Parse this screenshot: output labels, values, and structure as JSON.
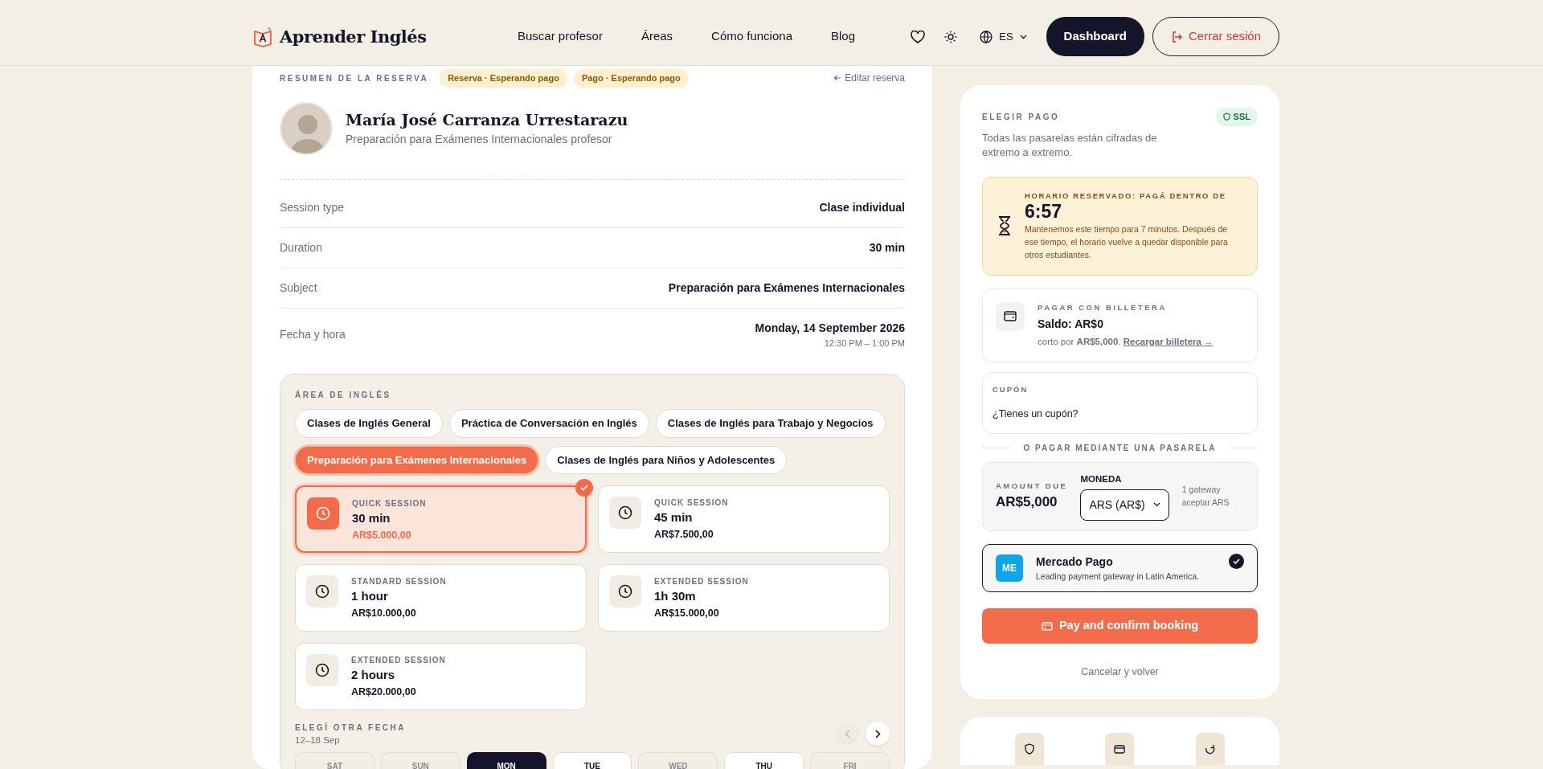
{
  "header": {
    "logo": "Aprender Inglés",
    "nav": [
      "Buscar profesor",
      "Áreas",
      "Cómo funciona",
      "Blog"
    ],
    "language": "ES",
    "dashboard": "Dashboard",
    "logout": "Cerrar sesión"
  },
  "summary": {
    "title": "RESUMEN DE LA RESERVA",
    "badges": [
      "Reserva · Esperando pago",
      "Pago · Esperando pago"
    ],
    "edit_link": "Editar reserva",
    "teacher": {
      "name": "María José Carranza Urrestarazu",
      "subtitle": "Preparación para Exámenes Internacionales profesor"
    },
    "rows": [
      {
        "label": "Session type",
        "value": "Clase individual"
      },
      {
        "label": "Duration",
        "value": "30 min"
      },
      {
        "label": "Subject",
        "value": "Preparación para Exámenes Internacionales"
      },
      {
        "label": "Fecha y hora",
        "value": "Monday, 14 September 2026",
        "subvalue": "12:30 PM – 1:00 PM"
      }
    ]
  },
  "area": {
    "title": "ÁREA DE INGLÉS",
    "chips": [
      {
        "label": "Clases de Inglés General",
        "selected": false
      },
      {
        "label": "Práctica de Conversación en Inglés",
        "selected": false
      },
      {
        "label": "Clases de Inglés para Trabajo y Negocios",
        "selected": false
      },
      {
        "label": "Preparación para Exámenes Internacionales",
        "selected": true
      },
      {
        "label": "Clases de Inglés para Niños y Adolescentes",
        "selected": false
      }
    ],
    "sessions": [
      {
        "type": "QUICK SESSION",
        "duration": "30 min",
        "price": "AR$5.000,00",
        "selected": true
      },
      {
        "type": "QUICK SESSION",
        "duration": "45 min",
        "price": "AR$7.500,00",
        "selected": false
      },
      {
        "type": "STANDARD SESSION",
        "duration": "1 hour",
        "price": "AR$10.000,00",
        "selected": false
      },
      {
        "type": "EXTENDED SESSION",
        "duration": "1h 30m",
        "price": "AR$15.000,00",
        "selected": false
      },
      {
        "type": "EXTENDED SESSION",
        "duration": "2 hours",
        "price": "AR$20.000,00",
        "selected": false
      }
    ],
    "date_picker": {
      "title": "ELEGÍ OTRA FECHA",
      "range": "12–18 Sep",
      "prev_disabled": true,
      "days": [
        {
          "label": "SAT",
          "selected": false,
          "available": false
        },
        {
          "label": "SUN",
          "selected": false,
          "available": false
        },
        {
          "label": "MON",
          "selected": true,
          "available": true
        },
        {
          "label": "TUE",
          "selected": false,
          "available": true
        },
        {
          "label": "WED",
          "selected": false,
          "available": false
        },
        {
          "label": "THU",
          "selected": false,
          "available": true
        },
        {
          "label": "FRI",
          "selected": false,
          "available": false
        }
      ]
    }
  },
  "payment": {
    "title": "ELEGIR PAGO",
    "ssl": "SSL",
    "description": "Todas las pasarelas están cifradas de extremo a extremo.",
    "timer": {
      "title": "HORARIO RESERVADO: PAGÁ DENTRO DE",
      "time": "6:57",
      "note": "Mantenemos este tiempo para 7 minutos. Después de ese tiempo, el horario vuelve a quedar disponible para otros estudiantes."
    },
    "wallet": {
      "title": "PAGAR CON BILLETERA",
      "balance": "Saldo: AR$0",
      "note": "corto por **AR$5,000**.",
      "link": "Recargar billetera →"
    },
    "coupon": {
      "label": "CUPÓN",
      "placeholder": "¿Tienes un cupón?"
    },
    "divider": "O PAGAR MEDIANTE UNA PASARELA",
    "amount": {
      "label": "AMOUNT DUE",
      "value": "AR$5,000"
    },
    "currency": {
      "label": "MONEDA",
      "value": "ARS (AR$)"
    },
    "gateway_note": "1 gateway aceptar ARS",
    "gateway": {
      "initials": "ME",
      "name": "Mercado Pago",
      "description": "Leading payment gateway in Latin America.",
      "selected": true
    },
    "pay_button": "Pay and confirm booking",
    "cancel": "Cancelar y volver"
  }
}
